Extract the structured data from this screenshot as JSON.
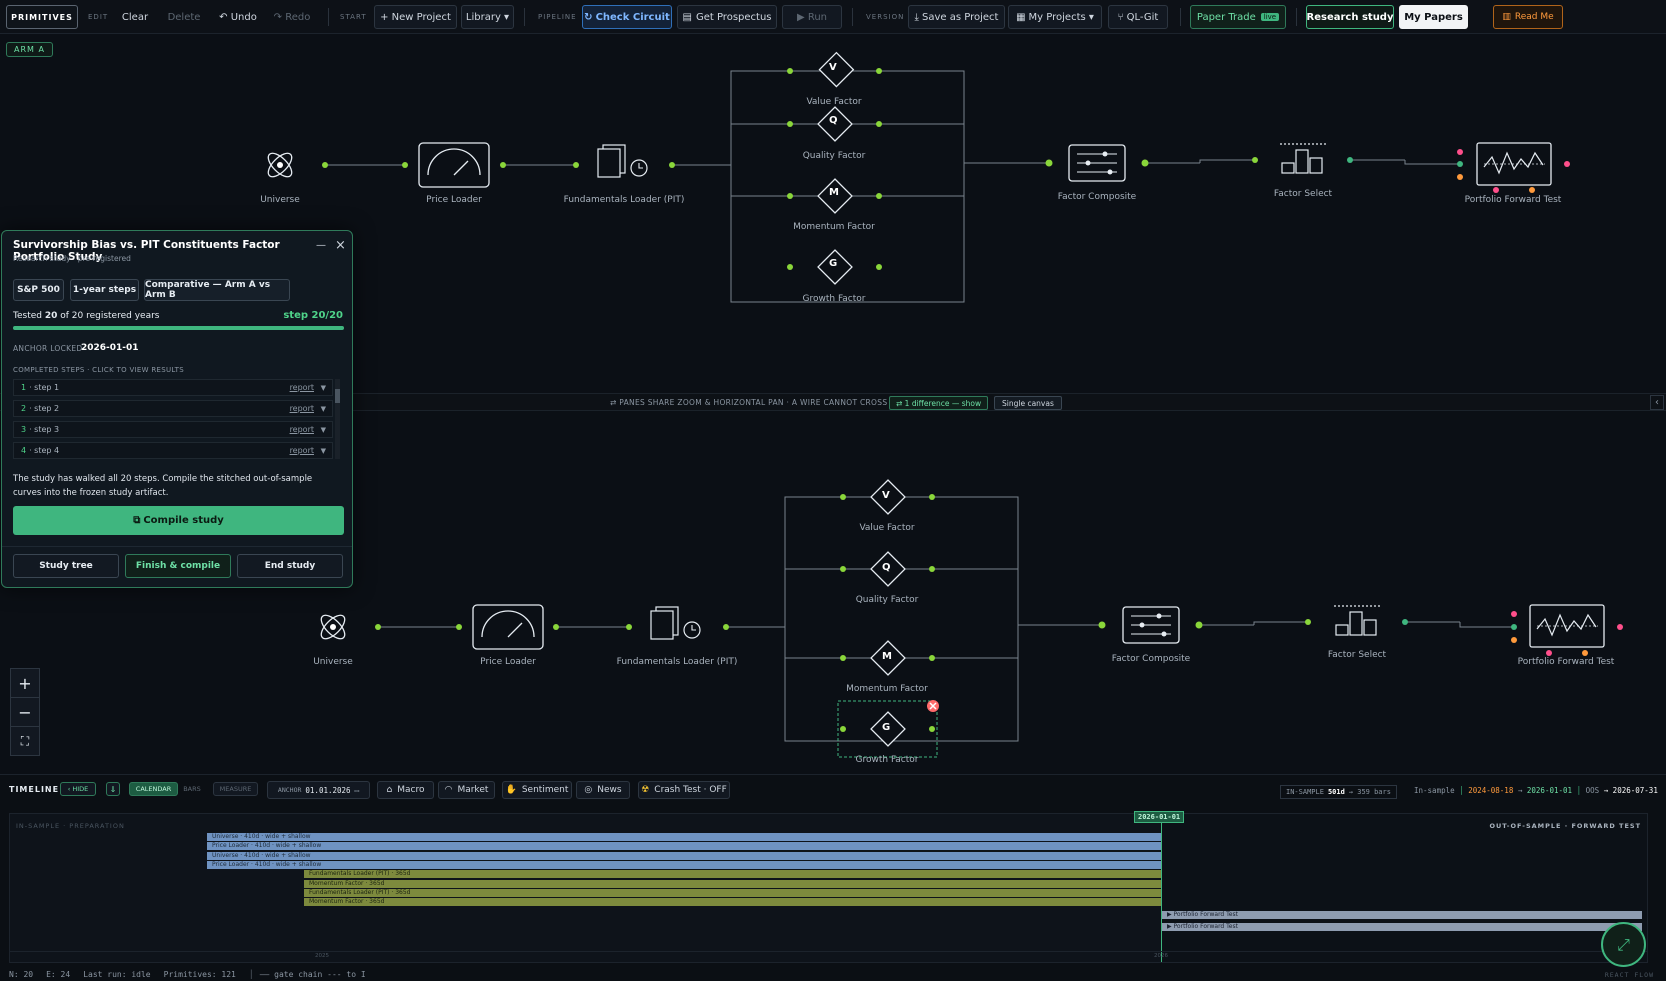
{
  "toolbar": {
    "primitives": "PRIMITIVES",
    "edit_section": "EDIT",
    "clear": "Clear",
    "delete": "Delete",
    "undo": "↶ Undo",
    "redo": "↷ Redo",
    "start_section": "START",
    "new_project": "+ New Project",
    "library": "Library ▾",
    "pipeline_section": "PIPELINE",
    "check_circuit": "Check Circuit",
    "get_prospectus": "Get Prospectus",
    "run": "▶ Run",
    "version_section": "VERSION",
    "save_as_project": "Save as Project",
    "my_projects": "My Projects ▾",
    "ql_git": "QL-Git",
    "paper_trade": "Paper Trade",
    "paper_trade_badge": "live",
    "research_study": "Research study",
    "my_papers": "My Papers",
    "read_me": "Read Me"
  },
  "arm_badge": "ARM A",
  "pipeline": {
    "universe": "Universe",
    "price_loader": "Price Loader",
    "fundamentals_loader": "Fundamentals Loader (PIT)",
    "value_factor": "Value Factor",
    "quality_factor": "Quality Factor",
    "momentum_factor": "Momentum Factor",
    "growth_factor": "Growth Factor",
    "factor_composite": "Factor Composite",
    "factor_select": "Factor Select",
    "portfolio_forward_test": "Portfolio Forward Test",
    "letters": {
      "v": "V",
      "q": "Q",
      "m": "M",
      "g": "G"
    }
  },
  "divider": {
    "note": "⇄ PANES SHARE ZOOM & HORIZONTAL PAN · A WIRE CANNOT CROSS ARMS",
    "difference": "⇄ 1 difference — show",
    "single_canvas": "Single canvas",
    "collapse": "‹"
  },
  "study": {
    "title": "Survivorship Bias vs. PIT Constituents Factor Portfolio Study",
    "subtitle": "Research study · pre-registered",
    "minimize": "—",
    "close": "×",
    "chips": [
      "S&P 500",
      "1-year steps",
      "Comparative — Arm A vs Arm B"
    ],
    "progress_prefix": "Tested ",
    "tested": "20",
    "progress_mid": " of 20 registered years",
    "step_label": "step 20/20",
    "progress_fraction": 1.0,
    "anchor_label": "ANCHOR LOCKED",
    "anchor_value": "2026-01-01",
    "completed_label": "COMPLETED STEPS · CLICK TO VIEW RESULTS",
    "steps": [
      {
        "num": "1",
        "label": "· step 1",
        "report": "report"
      },
      {
        "num": "2",
        "label": "· step 2",
        "report": "report"
      },
      {
        "num": "3",
        "label": "· step 3",
        "report": "report"
      },
      {
        "num": "4",
        "label": "· step 4",
        "report": "report"
      }
    ],
    "message": "The study has walked all 20 steps. Compile the stitched out-of-sample curves into the frozen study artifact.",
    "compile": "Compile study",
    "study_tree": "Study tree",
    "finish_compile": "Finish & compile",
    "end_study": "End study"
  },
  "zoom": {
    "plus": "+",
    "minus": "−",
    "fit": "⛶"
  },
  "timeline": {
    "label": "TIMELINE",
    "hide": "‹ HIDE",
    "pin": "⇓",
    "calendar": "CALENDAR",
    "bars": "BARS",
    "measure": "MEASURE",
    "anchor_label": "ANCHOR",
    "anchor_value": "01.01.2026",
    "macro": "Macro",
    "market": "Market",
    "sentiment": "Sentiment",
    "news": "News",
    "crash_test": "Crash Test · OFF",
    "in_sample_label": "IN-SAMPLE",
    "in_sample_days": "501d",
    "in_sample_bars": "→ 359 bars",
    "in_sample_range_label": "In-sample",
    "is_start": "2024-08-18",
    "is_end": "2026-01-01",
    "oos_label": "OOS",
    "oos_end": "→ 2026-07-31",
    "left_section": "IN-SAMPLE · PREPARATION",
    "right_section": "OUT-OF-SAMPLE · FORWARD TEST",
    "anchor_flag": "2026-01-01",
    "tick_2025": "2025",
    "tick_2026": "2026",
    "bars_list": [
      {
        "label": "Universe · 410d · wide + shallow",
        "kind": "blue"
      },
      {
        "label": "Price Loader · 410d · wide + shallow",
        "kind": "blue"
      },
      {
        "label": "Universe · 410d · wide + shallow",
        "kind": "blue"
      },
      {
        "label": "Price Loader · 410d · wide + shallow",
        "kind": "blue"
      },
      {
        "label": "Fundamentals Loader (PIT) · 365d",
        "kind": "olive"
      },
      {
        "label": "Momentum Factor · 365d",
        "kind": "olive"
      },
      {
        "label": "Fundamentals Loader (PIT) · 365d",
        "kind": "olive"
      },
      {
        "label": "Momentum Factor · 365d",
        "kind": "olive"
      }
    ],
    "forward_bars": [
      "▶ Portfolio Forward Test",
      "▶ Portfolio Forward Test"
    ]
  },
  "status": {
    "n": "N: 20",
    "e": "E: 24",
    "last_run": "Last run: idle",
    "primitives": "Primitives: 121",
    "legend": "—— gate chain  --- to I",
    "brand": "REACT FLOW"
  },
  "colors": {
    "accent_green": "#3fb67f",
    "port_green": "#7bd83c",
    "port_pink": "#ff4f8b",
    "port_orange": "#ff9a3c",
    "check_blue": "#2f6fb8"
  }
}
